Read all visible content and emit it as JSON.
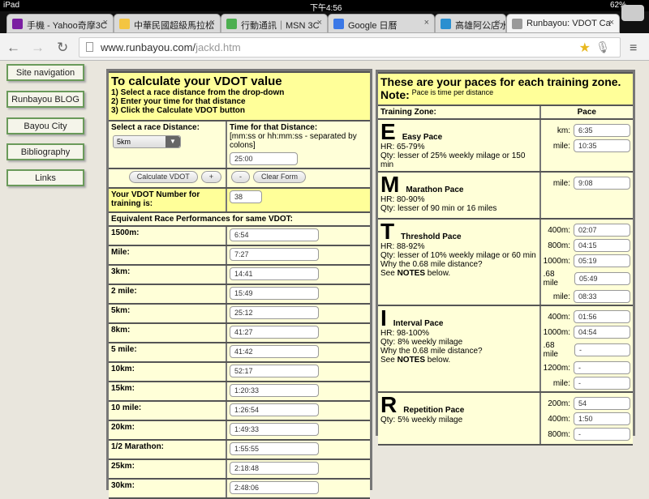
{
  "status": {
    "device": "iPad",
    "time": "下午4:56",
    "battery": "62%"
  },
  "tabs": [
    {
      "title": "手機 - Yahoo奇摩3C",
      "color": "#7b1fa2"
    },
    {
      "title": "中華民國超級馬拉松",
      "color": "#f4c542"
    },
    {
      "title": "行動通訊｜MSN 3C",
      "color": "#4caf50"
    },
    {
      "title": "Google 日曆",
      "color": "#3b78e7"
    },
    {
      "title": "高雄阿公店水",
      "color": "#2a8fd0"
    },
    {
      "title": "Runbayou: VDOT Ca",
      "color": "#999999"
    }
  ],
  "url": {
    "host": "www.runbayou.com/",
    "path": "jackd.htm"
  },
  "sidebar": [
    "Site navigation",
    "Runbayou BLOG",
    "Bayou City",
    "Bibliography",
    "Links"
  ],
  "calc": {
    "title": "To calculate your VDOT value",
    "steps": [
      "1) Select a race distance from the drop-down",
      "2) Enter your time for that distance",
      "3) Click the Calculate VDOT button"
    ],
    "select_label": "Select a race Distance:",
    "select_value": "5km",
    "time_label": "Time for that Distance:",
    "time_hint": "[mm:ss or hh:mm:ss - separated by colons]",
    "time_value": "25:00",
    "buttons": [
      "Calculate VDOT",
      "+",
      "-",
      "Clear Form"
    ],
    "vdot_label": "Your VDOT Number for training is:",
    "vdot_value": "38",
    "equiv_header": "Equivalent Race Performances for same VDOT:",
    "races": [
      [
        "1500m:",
        "6:54"
      ],
      [
        "Mile:",
        "7:27"
      ],
      [
        "3km:",
        "14:41"
      ],
      [
        "2 mile:",
        "15:49"
      ],
      [
        "5km:",
        "25:12"
      ],
      [
        "8km:",
        "41:27"
      ],
      [
        "5 mile:",
        "41:42"
      ],
      [
        "10km:",
        "52:17"
      ],
      [
        "15km:",
        "1:20:33"
      ],
      [
        "10 mile:",
        "1:26:54"
      ],
      [
        "20km:",
        "1:49:33"
      ],
      [
        "1/2 Marathon:",
        "1:55:55"
      ],
      [
        "25km:",
        "2:18:48"
      ],
      [
        "30km:",
        "2:48:06"
      ]
    ]
  },
  "paces": {
    "title": "These are your paces for each training zone.",
    "note_label": "Note:",
    "note": "Pace is time per distance",
    "col_zone": "Training Zone:",
    "col_pace": "Pace",
    "zones": [
      {
        "letter": "E",
        "name": "Easy Pace",
        "lines": [
          "HR: 65-79%",
          "Qty: lesser of 25% weekly milage or 150 min"
        ],
        "paces": [
          [
            "km:",
            "6:35"
          ],
          [
            "mile:",
            "10:35"
          ]
        ]
      },
      {
        "letter": "M",
        "name": "Marathon Pace",
        "lines": [
          "HR: 80-90%",
          "Qty: lesser of 90 min or 16 miles"
        ],
        "paces": [
          [
            "mile:",
            "9:08"
          ]
        ]
      },
      {
        "letter": "T",
        "name": "Threshold Pace",
        "lines": [
          "HR: 88-92%",
          "Qty: lesser of 10% weekly milage or 60 min",
          "Why the 0.68 mile distance?"
        ],
        "see": [
          "See ",
          "NOTES",
          " below."
        ],
        "paces": [
          [
            "400m:",
            "02:07"
          ],
          [
            "800m:",
            "04:15"
          ],
          [
            "1000m:",
            "05:19"
          ],
          [
            ".68 mile",
            "05:49"
          ],
          [
            "mile:",
            "08:33"
          ]
        ]
      },
      {
        "letter": "I",
        "name": "Interval Pace",
        "lines": [
          "HR: 98-100%",
          "Qty: 8% weekly milage",
          "Why the 0.68 mile distance?"
        ],
        "see": [
          "See ",
          "NOTES",
          " below."
        ],
        "paces": [
          [
            "400m:",
            "01:56"
          ],
          [
            "1000m:",
            "04:54"
          ],
          [
            ".68 mile",
            "-"
          ],
          [
            "1200m:",
            "-"
          ],
          [
            "mile:",
            "-"
          ]
        ]
      },
      {
        "letter": "R",
        "name": "Repetition Pace",
        "lines": [
          "Qty: 5% weekly milage"
        ],
        "paces": [
          [
            "200m:",
            "54"
          ],
          [
            "400m:",
            "1:50"
          ],
          [
            "800m:",
            "-"
          ]
        ]
      }
    ]
  }
}
